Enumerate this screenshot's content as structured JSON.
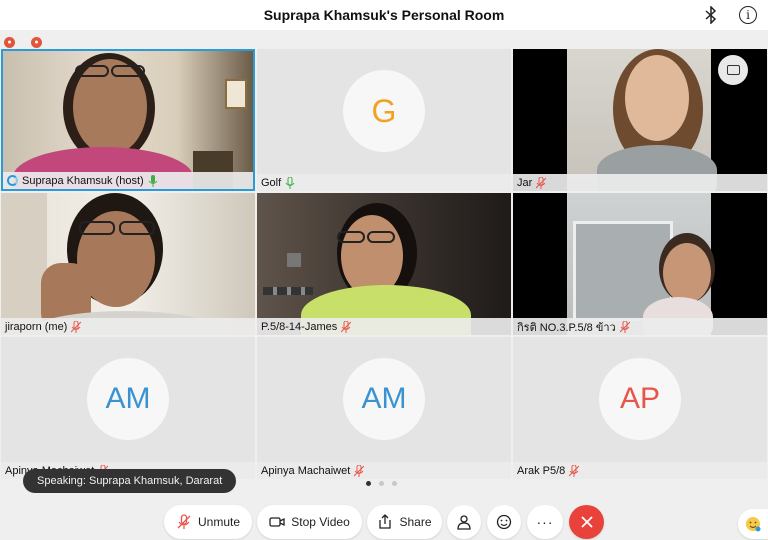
{
  "header": {
    "title": "Suprapa Khamsuk's Personal Room",
    "bluetooth_icon": "bluetooth-icon",
    "info_icon": "info-icon",
    "info_glyph": "i"
  },
  "tiles": [
    {
      "name": "Suprapa Khamsuk (host)",
      "type": "video",
      "mic": "on",
      "active": true
    },
    {
      "name": "Golf",
      "type": "avatar",
      "initials": "G",
      "mic": "on"
    },
    {
      "name": "Jar",
      "type": "video",
      "mic": "muted"
    },
    {
      "name": "jiraporn (me)",
      "type": "video",
      "mic": "muted"
    },
    {
      "name": "P.5/8-14-James",
      "type": "video",
      "mic": "muted"
    },
    {
      "name": "กิรติ NO.3.P.5/8 ข้าว",
      "type": "video",
      "mic": "muted"
    },
    {
      "name": "Apinya Machaiwet",
      "type": "avatar",
      "initials": "AM",
      "mic": "muted"
    },
    {
      "name": "Apinya Machaiwet",
      "type": "avatar",
      "initials": "AM",
      "mic": "muted"
    },
    {
      "name": "Arak P5/8",
      "type": "avatar",
      "initials": "AP",
      "mic": "muted"
    }
  ],
  "toast": {
    "text": "Speaking: Suprapa Khamsuk, Dararat"
  },
  "pager": {
    "pages": 3,
    "current": 1
  },
  "toolbar": {
    "unmute_label": "Unmute",
    "stop_video_label": "Stop Video",
    "share_label": "Share",
    "more_glyph": "···"
  },
  "colors": {
    "accent": "#2a9bd6",
    "end_call": "#e8423a",
    "muted_mic": "#e7564a",
    "active_mic": "#3cb043"
  }
}
